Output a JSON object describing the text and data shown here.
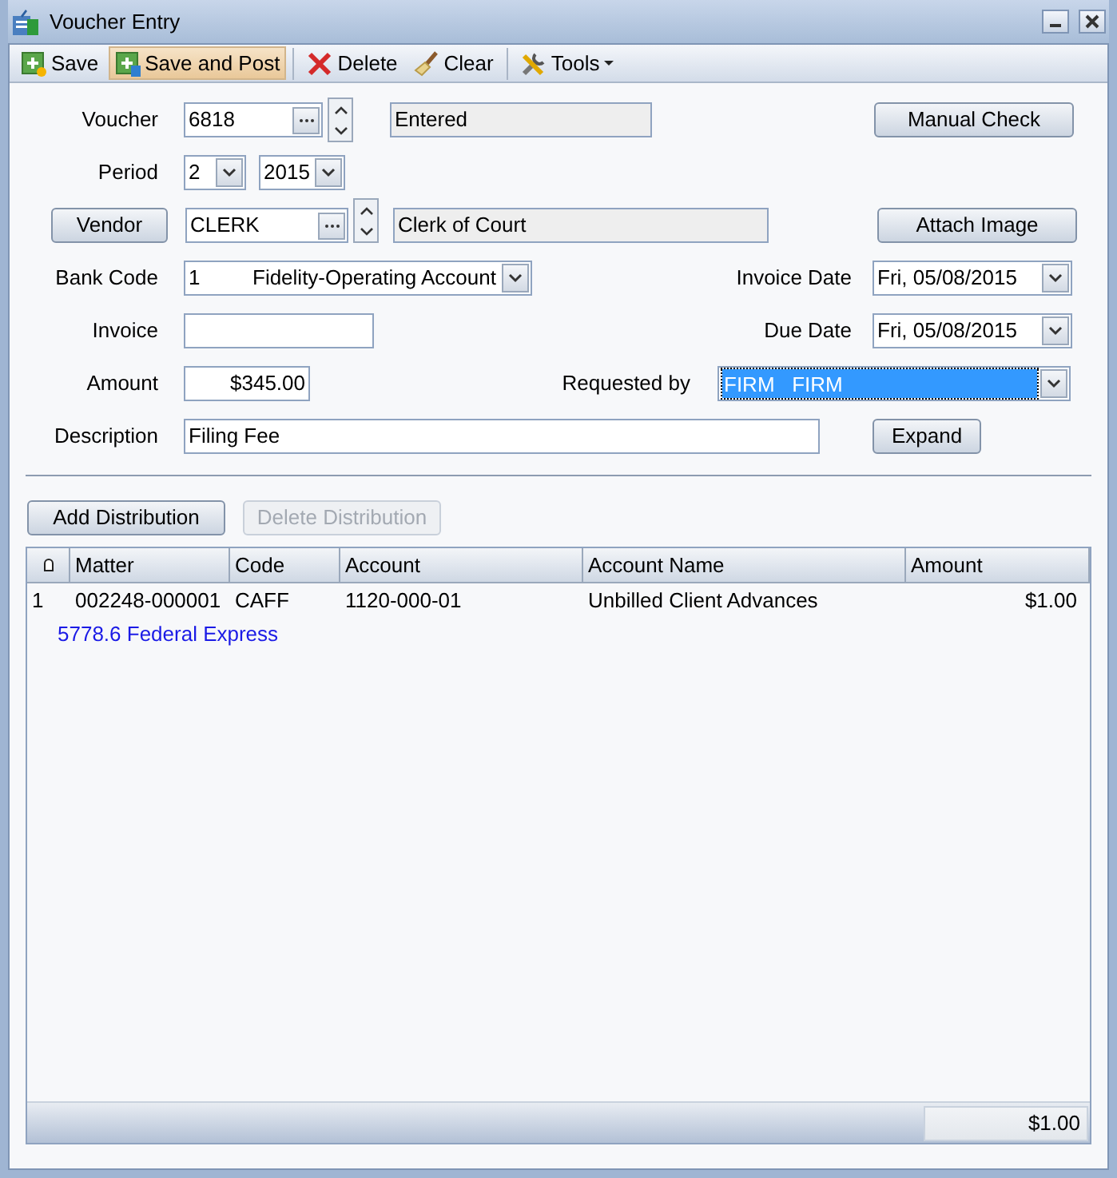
{
  "window": {
    "title": "Voucher Entry"
  },
  "toolbar": [
    {
      "kind": "save",
      "label": "Save",
      "hovered": false
    },
    {
      "kind": "post",
      "label": "Save and Post",
      "hovered": true
    },
    {
      "kind": "delete",
      "label": "Delete",
      "hovered": false
    },
    {
      "kind": "clear",
      "label": "Clear",
      "hovered": false
    },
    {
      "kind": "tools",
      "label": "Tools",
      "hovered": false
    }
  ],
  "form": {
    "voucher": {
      "label": "Voucher",
      "value": "6818",
      "status": "Entered"
    },
    "manual_check_button": "Manual Check",
    "period": {
      "label": "Period",
      "month": "2",
      "year": "2015"
    },
    "vendor": {
      "button": "Vendor",
      "code": "CLERK",
      "name": "Clerk of Court"
    },
    "attach_image_button": "Attach Image",
    "bank_code": {
      "label": "Bank Code",
      "code": "1",
      "name": "Fidelity-Operating Account"
    },
    "invoice_date": {
      "label": "Invoice Date",
      "value": "Fri, 05/08/2015"
    },
    "invoice": {
      "label": "Invoice"
    },
    "due_date": {
      "label": "Due Date",
      "value": "Fri, 05/08/2015"
    },
    "amount": {
      "label": "Amount",
      "value": "$345.00"
    },
    "requested_by": {
      "label": "Requested by",
      "value": "FIRM   FIRM",
      "selected": true
    },
    "description": {
      "label": "Description",
      "value": "Filing Fee"
    },
    "expand_button": "Expand"
  },
  "distribution_buttons": [
    {
      "label": "Add Distribution",
      "disabled": false
    },
    {
      "label": "Delete Distribution",
      "disabled": true
    }
  ],
  "table": {
    "columns": [
      "Matter",
      "Code",
      "Account",
      "Account Name",
      "Amount"
    ],
    "rows": [
      {
        "number": "1",
        "matter": "002248-000001",
        "code": "CAFF",
        "account": "1120-000-01",
        "account_name": "Unbilled Client Advances",
        "amount": "$1.00",
        "detail": "5778.6 Federal Express"
      }
    ],
    "total": "$1.00"
  }
}
